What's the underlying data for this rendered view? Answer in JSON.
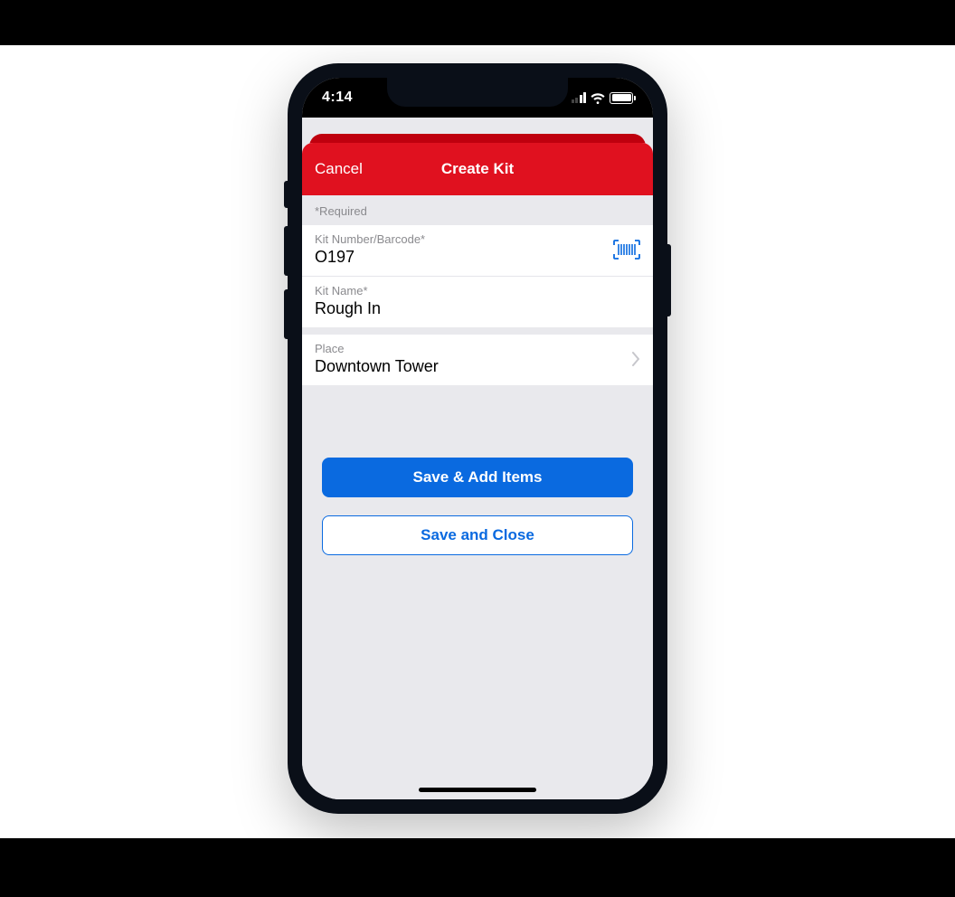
{
  "status": {
    "time": "4:14"
  },
  "nav": {
    "cancel": "Cancel",
    "title": "Create Kit"
  },
  "form": {
    "required_note": "*Required",
    "kit_number": {
      "label": "Kit Number/Barcode*",
      "value": "O197"
    },
    "kit_name": {
      "label": "Kit Name*",
      "value": "Rough In"
    },
    "place": {
      "label": "Place",
      "value": "Downtown Tower"
    }
  },
  "buttons": {
    "save_add": "Save & Add Items",
    "save_close": "Save and Close"
  }
}
